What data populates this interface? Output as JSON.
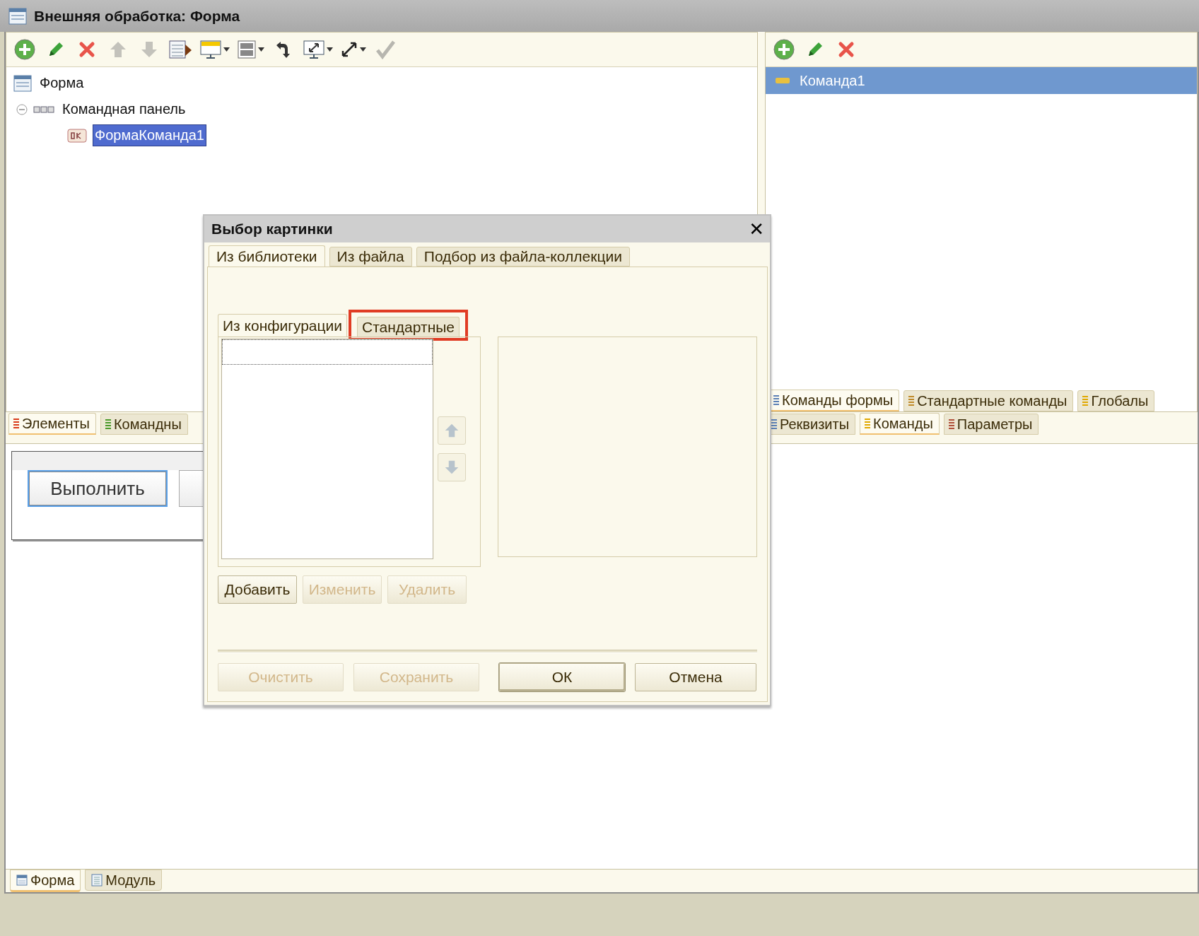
{
  "window": {
    "title": "Внешняя обработка: Форма"
  },
  "left_toolbar": [
    {
      "kind": "add",
      "disabled": false,
      "dropdown": false
    },
    {
      "kind": "edit",
      "disabled": false,
      "dropdown": false
    },
    {
      "kind": "delete",
      "disabled": false,
      "dropdown": false
    },
    {
      "kind": "up",
      "disabled": true,
      "dropdown": false
    },
    {
      "kind": "down",
      "disabled": true,
      "dropdown": false
    },
    {
      "kind": "table",
      "disabled": false,
      "dropdown": false
    },
    {
      "kind": "monitor",
      "disabled": false,
      "dropdown": true
    },
    {
      "kind": "layout",
      "disabled": false,
      "dropdown": true
    },
    {
      "kind": "swap",
      "disabled": false,
      "dropdown": false
    },
    {
      "kind": "screen-resize",
      "disabled": false,
      "dropdown": true
    },
    {
      "kind": "resize",
      "disabled": false,
      "dropdown": true
    },
    {
      "kind": "check",
      "disabled": true,
      "dropdown": false
    }
  ],
  "tree": [
    {
      "label": "Форма",
      "kind": "form",
      "selected": false,
      "children": [
        {
          "label": "Командная панель",
          "kind": "command-bar",
          "expanded": true,
          "selected": false,
          "children": [
            {
              "label": "ФормаКоманда1",
              "kind": "ok",
              "selected": true
            }
          ]
        }
      ]
    }
  ],
  "right_toolbar": [
    {
      "kind": "add",
      "disabled": false,
      "dropdown": false
    },
    {
      "kind": "edit",
      "disabled": false,
      "dropdown": false
    },
    {
      "kind": "delete",
      "disabled": false,
      "dropdown": false
    }
  ],
  "commands": [
    {
      "label": "Команда1",
      "selected": true
    }
  ],
  "right_tabs_upper": [
    {
      "label": "Команды формы",
      "selected": true,
      "color": "#5b7fb5"
    },
    {
      "label": "Стандартные команды",
      "selected": false,
      "color": "#c08a2a"
    },
    {
      "label": "Глобалы",
      "selected": false,
      "color": "#e0a800"
    }
  ],
  "left_tabs": [
    {
      "label": "Элементы",
      "selected": true,
      "color": "#d93a1a"
    },
    {
      "label": "Командны",
      "selected": false,
      "color": "#4a9a2a"
    }
  ],
  "right_tabs_lower": [
    {
      "label": "Реквизиты",
      "selected": false,
      "color": "#5b7fb5"
    },
    {
      "label": "Команды",
      "selected": true,
      "color": "#e0a800"
    },
    {
      "label": "Параметры",
      "selected": false,
      "color": "#b0503a"
    }
  ],
  "preview": {
    "buttons": [
      {
        "label": "Выполнить",
        "focused": true
      },
      {
        "focused": false
      }
    ]
  },
  "bottom_tabs": [
    {
      "label": "Форма",
      "selected": true,
      "kind": "form"
    },
    {
      "label": "Модуль",
      "selected": false,
      "kind": "module"
    }
  ],
  "dialog": {
    "title": "Выбор картинки",
    "close": "✕",
    "tabs": [
      {
        "label": "Из библиотеки",
        "selected": true
      },
      {
        "label": "Из файла",
        "selected": false
      },
      {
        "label": "Подбор из файла-коллекции",
        "selected": false
      }
    ],
    "subtabs": [
      {
        "label": "Из конфигурации",
        "selected": true,
        "highlighted": false
      },
      {
        "label": "Стандартные",
        "selected": false,
        "highlighted": true
      }
    ],
    "arrows": [
      {
        "kind": "up",
        "disabled": true
      },
      {
        "kind": "down",
        "disabled": true
      }
    ],
    "list_buttons": [
      {
        "label": "Добавить",
        "disabled": false
      },
      {
        "label": "Изменить",
        "disabled": true
      },
      {
        "label": "Удалить",
        "disabled": true
      }
    ],
    "footer_buttons": [
      {
        "label": "Очистить",
        "disabled": true,
        "default": false
      },
      {
        "label": "Сохранить",
        "disabled": true,
        "default": false
      },
      {
        "label": "ОК",
        "disabled": false,
        "default": true
      },
      {
        "label": "Отмена",
        "disabled": false,
        "default": false
      }
    ]
  }
}
